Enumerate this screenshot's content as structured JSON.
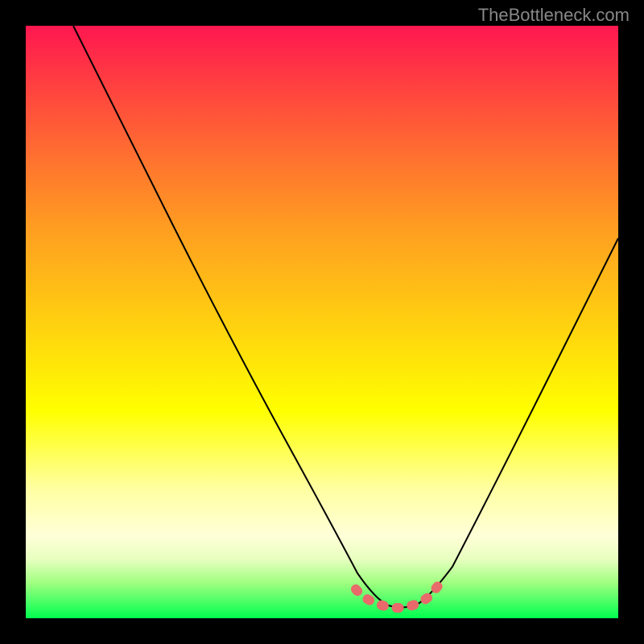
{
  "watermark": "TheBottleneck.com",
  "chart_data": {
    "type": "line",
    "title": "",
    "xlabel": "",
    "ylabel": "",
    "xlim": [
      0,
      100
    ],
    "ylim": [
      0,
      100
    ],
    "series": [
      {
        "name": "bottleneck-curve",
        "x": [
          8,
          15,
          25,
          35,
          45,
          52,
          56,
          59,
          62,
          65,
          68,
          72,
          80,
          90,
          100
        ],
        "y": [
          100,
          86,
          66,
          47,
          28,
          15,
          8,
          3,
          1,
          1,
          3,
          8,
          20,
          38,
          56
        ]
      }
    ],
    "highlight_range_x": [
      56,
      68
    ],
    "gradient": {
      "top_color": "#ff1750",
      "bottom_color": "#00ff50"
    }
  }
}
